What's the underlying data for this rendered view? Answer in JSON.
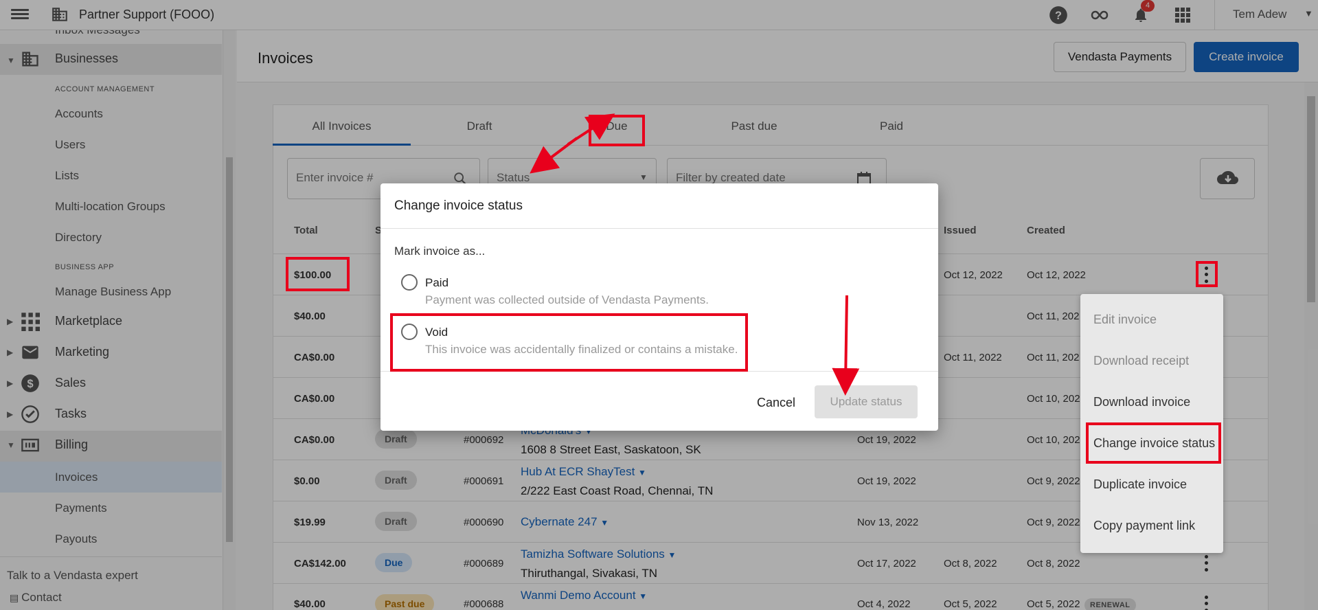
{
  "topbar": {
    "partner_name": "Partner Support (FOOO)",
    "notification_count": "4",
    "user_name": "Tem Adew"
  },
  "sidebar": {
    "partial_item": "Inbox Messages",
    "businesses": "Businesses",
    "account_management_heading": "ACCOUNT MANAGEMENT",
    "accounts": "Accounts",
    "users": "Users",
    "lists": "Lists",
    "multi_location": "Multi-location Groups",
    "directory": "Directory",
    "business_app_heading": "BUSINESS APP",
    "manage_business_app": "Manage Business App",
    "marketplace": "Marketplace",
    "marketing": "Marketing",
    "sales": "Sales",
    "tasks": "Tasks",
    "billing": "Billing",
    "invoices": "Invoices",
    "payments": "Payments",
    "payouts": "Payouts",
    "talk_expert": "Talk to a Vendasta expert",
    "contact": "Contact"
  },
  "header": {
    "title": "Invoices",
    "vendasta_payments": "Vendasta Payments",
    "create_invoice": "Create invoice"
  },
  "tabs": [
    "All Invoices",
    "Draft",
    "Due",
    "Past due",
    "Paid"
  ],
  "filters": {
    "invoice_placeholder": "Enter invoice #",
    "status_placeholder": "Status",
    "date_placeholder": "Filter by created date"
  },
  "table": {
    "headers": {
      "total": "Total",
      "status": "S",
      "issued": "Issued",
      "created": "Created"
    },
    "rows": [
      {
        "total": "$100.00",
        "issued": "Oct 12, 2022",
        "created": "Oct 12, 2022"
      },
      {
        "total": "$40.00",
        "created": "Oct 11, 202"
      },
      {
        "total": "CA$0.00",
        "issued": "Oct 11, 2022",
        "created": "Oct 11, 202"
      },
      {
        "total": "CA$0.00",
        "created": "Oct 10, 202"
      },
      {
        "total": "CA$0.00",
        "status": "Draft",
        "number": "#000692",
        "customer": "McDonald's",
        "address": "1608 8 Street East, Saskatoon, SK",
        "due": "Oct 19, 2022",
        "created": "Oct 10, 202"
      },
      {
        "total": "$0.00",
        "status": "Draft",
        "number": "#000691",
        "customer": "Hub At ECR ShayTest",
        "address": "2/222 East Coast Road, Chennai, TN",
        "due": "Oct 19, 2022",
        "created": "Oct 9, 2022"
      },
      {
        "total": "$19.99",
        "status": "Draft",
        "number": "#000690",
        "customer": "Cybernate 247",
        "due": "Nov 13, 2022",
        "created": "Oct 9, 2022"
      },
      {
        "total": "CA$142.00",
        "status": "Due",
        "number": "#000689",
        "customer": "Tamizha Software Solutions",
        "address": "Thiruthangal, Sivakasi, TN",
        "due": "Oct 17, 2022",
        "issued": "Oct 8, 2022",
        "created": "Oct 8, 2022"
      },
      {
        "total": "$40.00",
        "status": "Past due",
        "number": "#000688",
        "customer": "Wanmi Demo Account",
        "due": "Oct 4, 2022",
        "issued": "Oct 5, 2022",
        "created": "Oct 5, 2022",
        "tag": "RENEWAL"
      }
    ]
  },
  "context_menu": {
    "items": [
      "Edit invoice",
      "Download receipt",
      "Download invoice",
      "Change invoice status",
      "Duplicate invoice",
      "Copy payment link"
    ]
  },
  "modal": {
    "title": "Change invoice status",
    "mark_as": "Mark invoice as...",
    "options": [
      {
        "label": "Paid",
        "description": "Payment was collected outside of Vendasta Payments."
      },
      {
        "label": "Void",
        "description": "This invoice was accidentally finalized or contains a mistake."
      }
    ],
    "cancel": "Cancel",
    "update": "Update status"
  },
  "colors": {
    "primary": "#1565c0",
    "annotation": "#e8001c"
  }
}
